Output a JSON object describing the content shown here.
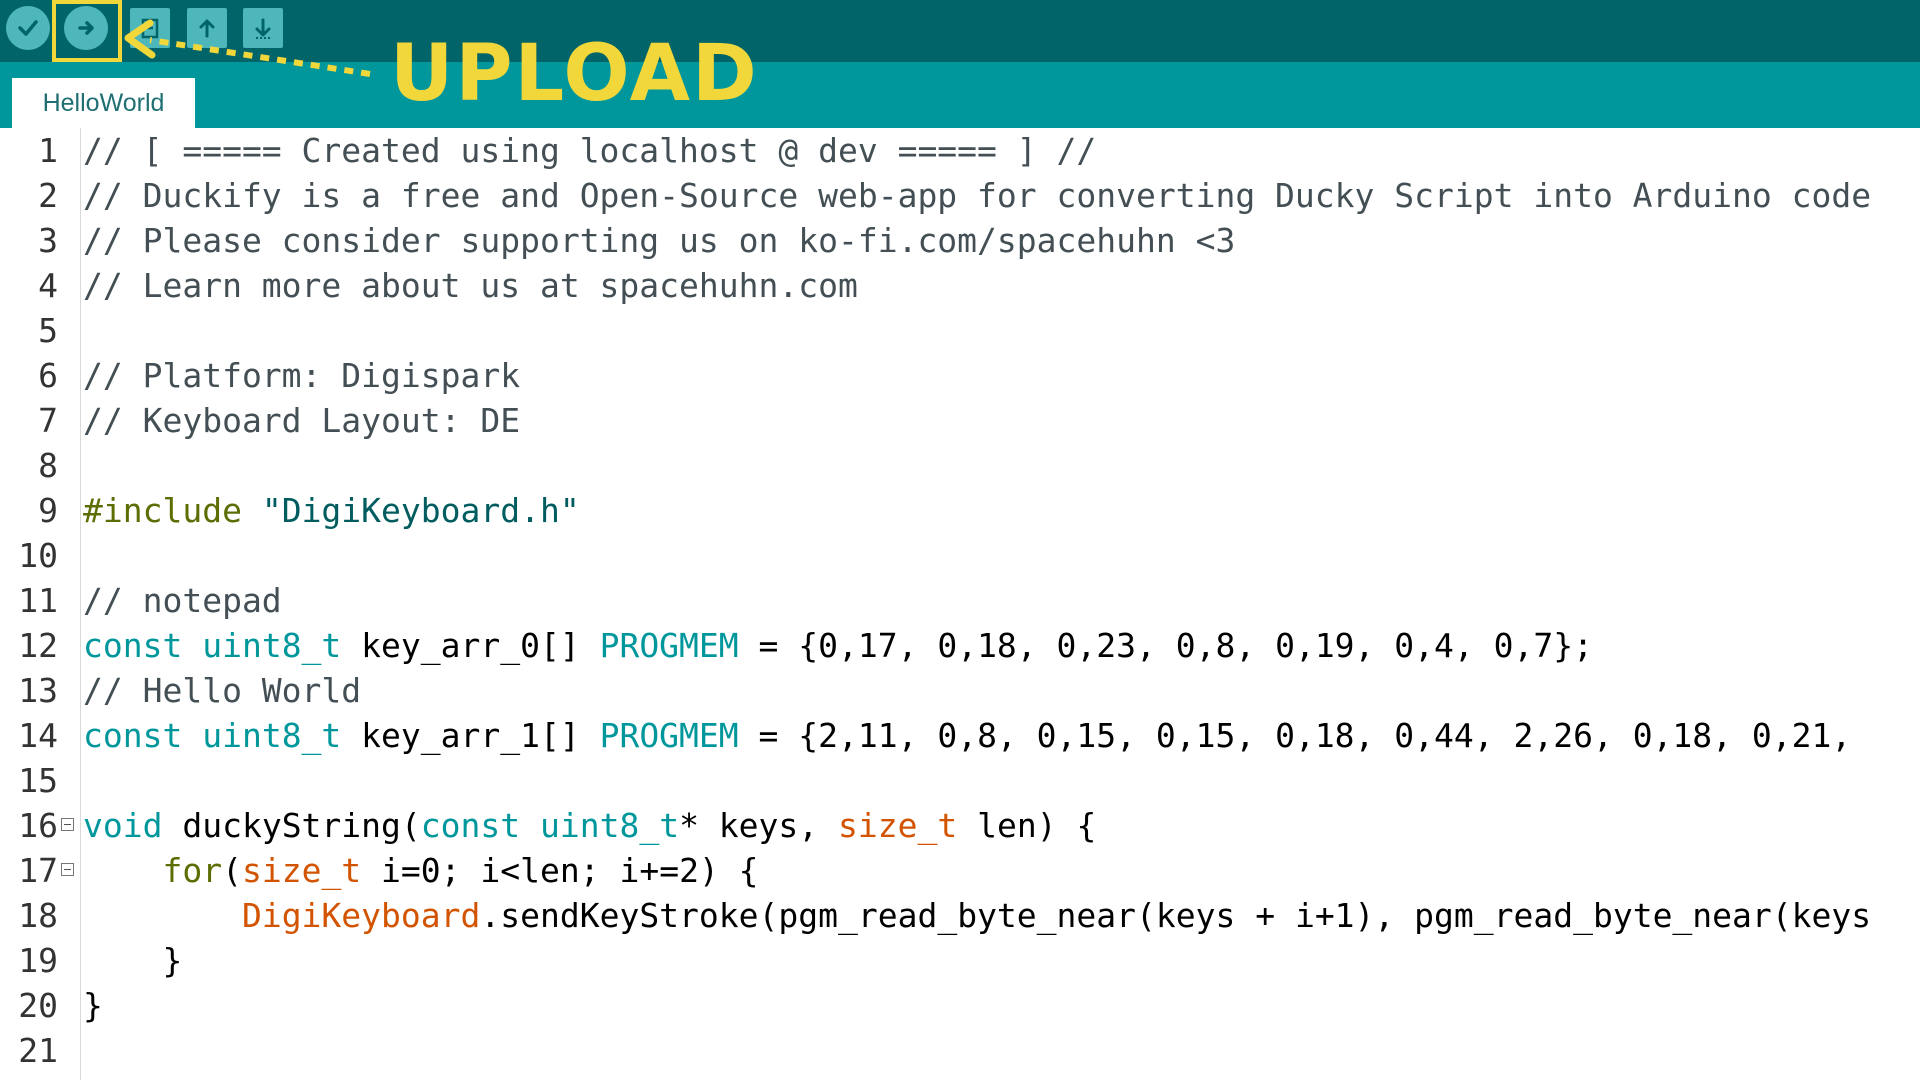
{
  "toolbar": {
    "buttons": [
      {
        "name": "verify-button",
        "icon": "check-icon"
      },
      {
        "name": "upload-button",
        "icon": "arrow-right-icon"
      },
      {
        "name": "new-button",
        "icon": "new-file-icon"
      },
      {
        "name": "open-button",
        "icon": "arrow-up-icon"
      },
      {
        "name": "save-button",
        "icon": "arrow-down-icon"
      }
    ]
  },
  "annotation": {
    "label": "UPLOAD",
    "color": "#f2d73b"
  },
  "tab": {
    "label": "HelloWorld"
  },
  "editor": {
    "line_numbers": [
      "1",
      "2",
      "3",
      "4",
      "5",
      "6",
      "7",
      "8",
      "9",
      "10",
      "11",
      "12",
      "13",
      "14",
      "15",
      "16",
      "17",
      "18",
      "19",
      "20",
      "21"
    ],
    "lines": [
      {
        "tokens": [
          {
            "t": "// [ ===== Created using localhost @ dev ===== ] //",
            "c": "comment"
          }
        ]
      },
      {
        "tokens": [
          {
            "t": "// Duckify is a free and Open-Source web-app for converting Ducky Script into Arduino code",
            "c": "comment"
          }
        ]
      },
      {
        "tokens": [
          {
            "t": "// Please consider supporting us on ko-fi.com/spacehuhn <3",
            "c": "comment"
          }
        ]
      },
      {
        "tokens": [
          {
            "t": "// Learn more about us at spacehuhn.com",
            "c": "comment"
          }
        ]
      },
      {
        "tokens": []
      },
      {
        "tokens": [
          {
            "t": "// Platform: Digispark",
            "c": "comment"
          }
        ]
      },
      {
        "tokens": [
          {
            "t": "// Keyboard Layout: DE",
            "c": "comment"
          }
        ]
      },
      {
        "tokens": []
      },
      {
        "tokens": [
          {
            "t": "#include",
            "c": "pre"
          },
          {
            "t": " ",
            "c": "plain"
          },
          {
            "t": "\"DigiKeyboard.h\"",
            "c": "str"
          }
        ]
      },
      {
        "tokens": []
      },
      {
        "tokens": [
          {
            "t": "// notepad",
            "c": "comment"
          }
        ]
      },
      {
        "tokens": [
          {
            "t": "const",
            "c": "type"
          },
          {
            "t": " ",
            "c": "plain"
          },
          {
            "t": "uint8_t",
            "c": "type"
          },
          {
            "t": " key_arr_0[] ",
            "c": "plain"
          },
          {
            "t": "PROGMEM",
            "c": "type"
          },
          {
            "t": " = {0,17, 0,18, 0,23, 0,8, 0,19, 0,4, 0,7};",
            "c": "plain"
          }
        ]
      },
      {
        "tokens": [
          {
            "t": "// Hello World",
            "c": "comment"
          }
        ]
      },
      {
        "tokens": [
          {
            "t": "const",
            "c": "type"
          },
          {
            "t": " ",
            "c": "plain"
          },
          {
            "t": "uint8_t",
            "c": "type"
          },
          {
            "t": " key_arr_1[] ",
            "c": "plain"
          },
          {
            "t": "PROGMEM",
            "c": "type"
          },
          {
            "t": " = {2,11, 0,8, 0,15, 0,15, 0,18, 0,44, 2,26, 0,18, 0,21,",
            "c": "plain"
          }
        ]
      },
      {
        "tokens": []
      },
      {
        "fold": true,
        "tokens": [
          {
            "t": "void",
            "c": "type"
          },
          {
            "t": " duckyString(",
            "c": "plain"
          },
          {
            "t": "const",
            "c": "type"
          },
          {
            "t": " ",
            "c": "plain"
          },
          {
            "t": "uint8_t",
            "c": "type"
          },
          {
            "t": "* keys, ",
            "c": "plain"
          },
          {
            "t": "size_t",
            "c": "orange"
          },
          {
            "t": " len) {",
            "c": "plain"
          }
        ]
      },
      {
        "fold": true,
        "tokens": [
          {
            "t": "    ",
            "c": "plain"
          },
          {
            "t": "for",
            "c": "kw"
          },
          {
            "t": "(",
            "c": "plain"
          },
          {
            "t": "size_t",
            "c": "orange"
          },
          {
            "t": " i=0; i<len; i+=2) {",
            "c": "plain"
          }
        ]
      },
      {
        "tokens": [
          {
            "t": "        ",
            "c": "plain"
          },
          {
            "t": "DigiKeyboard",
            "c": "orange"
          },
          {
            "t": ".sendKeyStroke(pgm_read_byte_near(keys + i+1), pgm_read_byte_near(keys",
            "c": "plain"
          }
        ]
      },
      {
        "tokens": [
          {
            "t": "    }",
            "c": "plain"
          }
        ]
      },
      {
        "tokens": [
          {
            "t": "}",
            "c": "plain"
          }
        ]
      },
      {
        "tokens": []
      }
    ]
  }
}
